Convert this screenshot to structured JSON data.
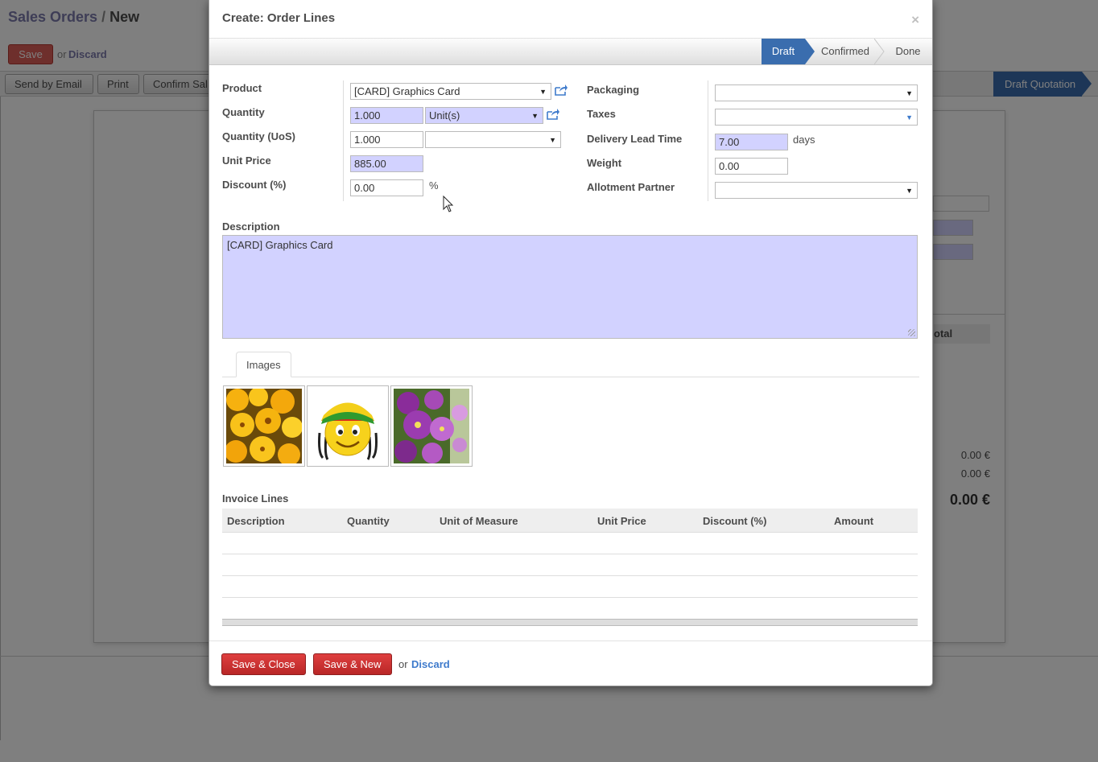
{
  "background": {
    "breadcrumb": {
      "parent": "Sales Orders",
      "separator": "/",
      "current": "New"
    },
    "save_label": "Save",
    "or_label": "or",
    "discard_label": "Discard",
    "toolbar": [
      "Send by Email",
      "Print",
      "Confirm Sal"
    ],
    "status": "Draft Quotation",
    "subtotal_header": "otal",
    "amounts": [
      "0.00 €",
      "0.00 €"
    ],
    "total": "0.00 €"
  },
  "modal": {
    "title": "Create: Order Lines",
    "close_glyph": "×",
    "stages": [
      "Draft",
      "Confirmed",
      "Done"
    ],
    "active_stage": "Draft",
    "left_fields": {
      "product": {
        "label": "Product",
        "value": "[CARD] Graphics Card"
      },
      "quantity": {
        "label": "Quantity",
        "value": "1.000",
        "uom": "Unit(s)"
      },
      "quantity_uos": {
        "label": "Quantity (UoS)",
        "value": "1.000",
        "uos": ""
      },
      "unit_price": {
        "label": "Unit Price",
        "value": "885.00"
      },
      "discount": {
        "label": "Discount (%)",
        "value": "0.00",
        "suffix": "%"
      }
    },
    "right_fields": {
      "packaging": {
        "label": "Packaging",
        "value": ""
      },
      "taxes": {
        "label": "Taxes",
        "value": ""
      },
      "delivery_lead_time": {
        "label": "Delivery Lead Time",
        "value": "7.00",
        "suffix": "days"
      },
      "weight": {
        "label": "Weight",
        "value": "0.00"
      },
      "allotment_partner": {
        "label": "Allotment Partner",
        "value": ""
      }
    },
    "description": {
      "label": "Description",
      "value": "[CARD] Graphics Card"
    },
    "tabs": [
      "Images"
    ],
    "images": [
      "yellow-flowers-image",
      "rasta-smiley-image",
      "purple-pansies-image"
    ],
    "invoice_lines": {
      "title": "Invoice Lines",
      "columns": [
        "Description",
        "Quantity",
        "Unit of Measure",
        "Unit Price",
        "Discount (%)",
        "Amount"
      ],
      "rows": []
    },
    "footer": {
      "save_close": "Save & Close",
      "save_new": "Save & New",
      "or": "or",
      "discard": "Discard"
    }
  },
  "colors": {
    "accent_blue": "#3a6dae",
    "required_field": "#d2d2ff",
    "primary_red": "#c63131",
    "link_blue": "#3f7bcc",
    "breadcrumb_purple": "#7c7bad"
  }
}
